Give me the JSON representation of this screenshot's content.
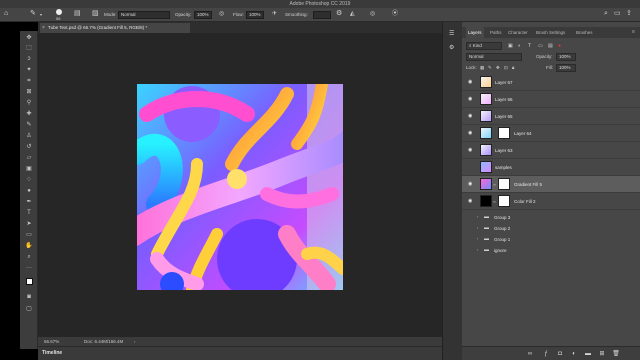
{
  "app": {
    "title": "Adobe Photoshop CC 2019"
  },
  "options": {
    "mode_label": "Mode:",
    "mode_value": "Normal",
    "opacity_label": "Opacity:",
    "opacity_value": "100%",
    "flow_label": "Flow:",
    "flow_value": "100%",
    "smoothing_label": "Smoothing:",
    "brush_size": "58"
  },
  "document": {
    "tab_title": "Tube Text.psd @ 66.7% (Gradient Fill 5, RGB/8) *",
    "zoom": "66.67%",
    "doc_info": "Doc: 6.44M/166.4M"
  },
  "timeline": {
    "label": "Timeline"
  },
  "panel": {
    "tabs": [
      "Layers",
      "Paths",
      "Character",
      "Brush Settings",
      "Brushes"
    ],
    "active_tab": "Layers",
    "filter_kind": "Kind",
    "blend_mode": "Normal",
    "opacity_label": "Opacity:",
    "opacity_value": "100%",
    "lock_label": "Lock:",
    "fill_label": "Fill:",
    "fill_value": "100%",
    "layers": [
      {
        "name": "Layer 67",
        "visible": true,
        "mask": false,
        "selected": false
      },
      {
        "name": "Layer 66",
        "visible": true,
        "mask": false,
        "selected": false
      },
      {
        "name": "Layer 65",
        "visible": true,
        "mask": false,
        "selected": false
      },
      {
        "name": "Layer 64",
        "visible": true,
        "mask": true,
        "selected": false
      },
      {
        "name": "Layer 63",
        "visible": true,
        "mask": false,
        "selected": false
      },
      {
        "name": "samples",
        "visible": false,
        "mask": false,
        "selected": false
      },
      {
        "name": "Gradient Fill 5",
        "visible": true,
        "mask": true,
        "selected": true
      },
      {
        "name": "Color Fill 2",
        "visible": true,
        "mask": true,
        "selected": false
      }
    ],
    "groups": [
      "Group 3",
      "Group 2",
      "Group 1",
      "ignore"
    ]
  },
  "colors": {
    "ui_dark": "#262626",
    "panel": "#474747",
    "selected": "#5d5d5d"
  }
}
